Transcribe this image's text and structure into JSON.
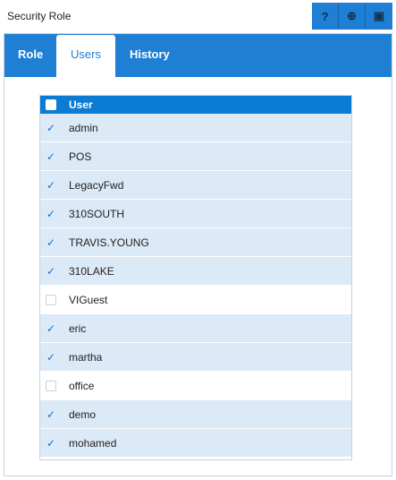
{
  "window": {
    "title": "Security Role"
  },
  "toolbar": {
    "buttons": [
      {
        "icon": "help-icon",
        "glyph": "?"
      },
      {
        "icon": "add-icon",
        "glyph": "⊕"
      },
      {
        "icon": "save-icon",
        "glyph": "▣"
      }
    ]
  },
  "tabs": [
    {
      "label": "Role"
    },
    {
      "label": "Users"
    },
    {
      "label": "History"
    }
  ],
  "grid": {
    "header": "User",
    "rows": [
      {
        "name": "admin",
        "checked": true,
        "mark": "✓"
      },
      {
        "name": "POS",
        "checked": true,
        "mark": "✓"
      },
      {
        "name": "LegacyFwd",
        "checked": true,
        "mark": "✓"
      },
      {
        "name": "310SOUTH",
        "checked": true,
        "mark": "✓"
      },
      {
        "name": "TRAVIS.YOUNG",
        "checked": true,
        "mark": "✓"
      },
      {
        "name": "310LAKE",
        "checked": true,
        "mark": "✓"
      },
      {
        "name": "VIGuest",
        "checked": false,
        "mark": ""
      },
      {
        "name": "eric",
        "checked": true,
        "mark": "✓"
      },
      {
        "name": "martha",
        "checked": true,
        "mark": "✓"
      },
      {
        "name": "office",
        "checked": false,
        "mark": ""
      },
      {
        "name": "demo",
        "checked": true,
        "mark": "✓"
      },
      {
        "name": "mohamed",
        "checked": true,
        "mark": "✓"
      }
    ]
  },
  "colors": {
    "accent": "#1e7fd4",
    "row_selected": "#dce9f7"
  }
}
